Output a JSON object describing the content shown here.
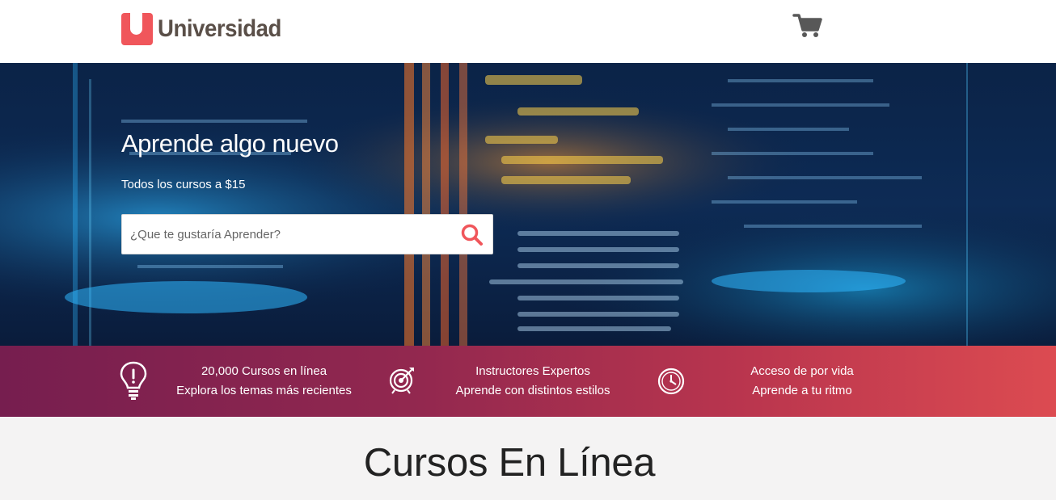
{
  "header": {
    "logo_text": "Universidad",
    "cart_icon": "shopping-cart-icon"
  },
  "hero": {
    "title": "Aprende algo nuevo",
    "subtitle": "Todos los cursos a $15",
    "search": {
      "placeholder": "¿Que te gustaría Aprender?",
      "value": "",
      "icon": "search-icon"
    }
  },
  "features": [
    {
      "icon": "lightbulb-icon",
      "title": "20,000 Cursos en línea",
      "subtitle": "Explora los temas más recientes"
    },
    {
      "icon": "target-icon",
      "title": "Instructores Expertos",
      "subtitle": "Aprende con distintos estilos"
    },
    {
      "icon": "clock-icon",
      "title": "Acceso de por vida",
      "subtitle": "Aprende a tu ritmo"
    }
  ],
  "section": {
    "title": "Cursos En Línea"
  },
  "colors": {
    "brand": "#f0565b",
    "logo_text": "#5a4f48",
    "features_gradient_start": "#761e4f",
    "features_gradient_end": "#dc4b51",
    "search_icon": "#f0565b"
  }
}
